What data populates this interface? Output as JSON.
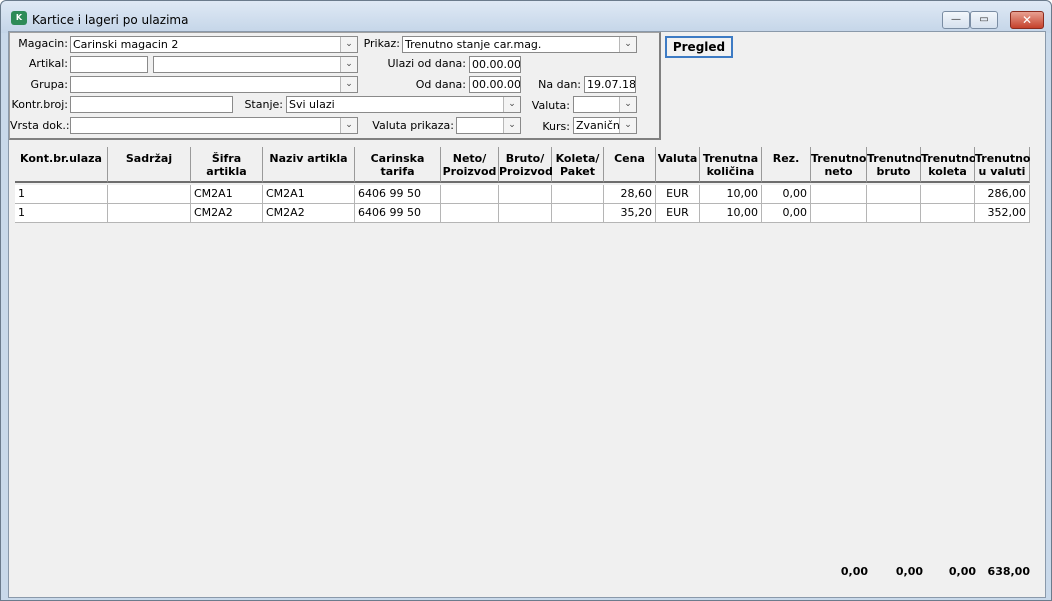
{
  "window": {
    "title": "Kartice i lageri po ulazima",
    "icon_text": "K"
  },
  "filters": {
    "magacin_label": "Magacin:",
    "magacin_value": "Carinski magacin 2",
    "prikaz_label": "Prikaz:",
    "prikaz_value": "Trenutno stanje car.mag.",
    "artikal_label": "Artikal:",
    "ulazi_od_label": "Ulazi od dana:",
    "ulazi_od_value": "00.00.00",
    "grupa_label": "Grupa:",
    "od_dana_label": "Od dana:",
    "od_dana_value": "00.00.00",
    "na_dan_label": "Na dan:",
    "na_dan_value": "19.07.18",
    "kontr_label": "Kontr.broj:",
    "stanje_label": "Stanje:",
    "stanje_value": "Svi ulazi",
    "valuta_label": "Valuta:",
    "vrsta_label": "Vrsta dok.:",
    "valuta_prikaza_label": "Valuta prikaza:",
    "kurs_label": "Kurs:",
    "kurs_value": "Zvanični"
  },
  "pregled_label": "Pregled",
  "columns": [
    {
      "l1": "Kont.br.ulaza",
      "l2": ""
    },
    {
      "l1": "Sadržaj",
      "l2": ""
    },
    {
      "l1": "Šifra artikla",
      "l2": ""
    },
    {
      "l1": "Naziv artikla",
      "l2": ""
    },
    {
      "l1": "Carinska tarifa",
      "l2": ""
    },
    {
      "l1": "Neto/",
      "l2": "Proizvod"
    },
    {
      "l1": "Bruto/",
      "l2": "Proizvod"
    },
    {
      "l1": "Koleta/",
      "l2": "Paket"
    },
    {
      "l1": "Cena",
      "l2": ""
    },
    {
      "l1": "Valuta",
      "l2": ""
    },
    {
      "l1": "Trenutna",
      "l2": "količina"
    },
    {
      "l1": "Rez.",
      "l2": ""
    },
    {
      "l1": "Trenutno",
      "l2": "neto"
    },
    {
      "l1": "Trenutno",
      "l2": "bruto"
    },
    {
      "l1": "Trenutno",
      "l2": "koleta"
    },
    {
      "l1": "Trenutno",
      "l2": "u valuti"
    }
  ],
  "rows": [
    [
      "1",
      "",
      "CM2A1",
      "CM2A1",
      "6406 99 50",
      "",
      "",
      "",
      "28,60",
      "EUR",
      "10,00",
      "0,00",
      "",
      "",
      "",
      "286,00"
    ],
    [
      "1",
      "",
      "CM2A2",
      "CM2A2",
      "6406 99 50",
      "",
      "",
      "",
      "35,20",
      "EUR",
      "10,00",
      "0,00",
      "",
      "",
      "",
      "352,00"
    ]
  ],
  "totals": [
    "0,00",
    "0,00",
    "0,00",
    "638,00"
  ]
}
